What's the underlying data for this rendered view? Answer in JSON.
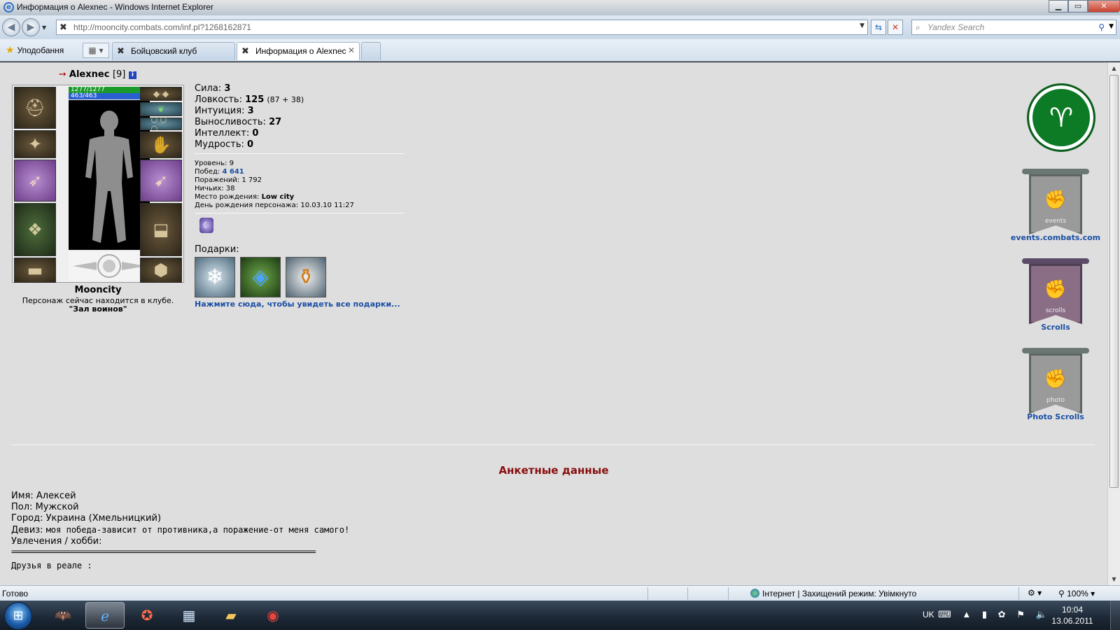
{
  "window": {
    "title": "Информация о Alexnec - Windows Internet Explorer",
    "minimize": "▁",
    "maximize": "▭",
    "close": "✕"
  },
  "address_bar": {
    "url": "http://mooncity.combats.com/inf.pl?1268162871",
    "search_placeholder": "Yandex Search"
  },
  "favorites": {
    "label": "Уподобання"
  },
  "tabs": [
    {
      "label": "Бойцовский клуб",
      "active": false
    },
    {
      "label": "Информация о Alexnec",
      "active": true
    }
  ],
  "character": {
    "name": "Alexnec",
    "level": "[9]",
    "hp": "1277/1277",
    "mp": "463/463",
    "club_city": "Mooncity",
    "location_note": "Персонаж сейчас находится в клубе.",
    "location_name": "\"Зал воинов\""
  },
  "stats": {
    "strength_label": "Сила:",
    "strength": "3",
    "agility_label": "Ловкость:",
    "agility": "125",
    "agility_detail": "(87 + 38)",
    "intuition_label": "Интуиция:",
    "intuition": "3",
    "endurance_label": "Выносливость:",
    "endurance": "27",
    "intellect_label": "Интеллект:",
    "intellect": "0",
    "wisdom_label": "Мудрость:",
    "wisdom": "0"
  },
  "info": {
    "level_label": "Уровень:",
    "level": "9",
    "wins_label": "Побед:",
    "wins": "4 641",
    "losses_label": "Поражений:",
    "losses": "1 792",
    "draws_label": "Ничьих:",
    "draws": "38",
    "birthplace_label": "Место рождения:",
    "birthplace": "Low city",
    "birthday_label": "День рождения персонажа:",
    "birthday": "10.03.10 11:27"
  },
  "gifts": {
    "label": "Подарки:",
    "link": "Нажмите сюда, чтобы увидеть все подарки..."
  },
  "side_links": [
    {
      "caption": "events.combats.com",
      "word": "events"
    },
    {
      "caption": "Scrolls",
      "word": "scrolls"
    },
    {
      "caption": "Photo Scrolls",
      "word": "photo"
    }
  ],
  "profile": {
    "heading": "Анкетные данные",
    "name_label": "Имя:",
    "name": "Алексей",
    "gender_label": "Пол:",
    "gender": "Мужской",
    "city_label": "Город:",
    "city": "Украина (Хмельницкий)",
    "motto_label": "Девиз:",
    "motto": "моя победа-зависит от противника,а поражение-от меня самого!",
    "hobby_label": "Увлечения / хобби:",
    "divider": "===================================================================================",
    "friends": "Друзья в реале :"
  },
  "statusbar": {
    "ready": "Готово",
    "zone": "Інтернет | Захищений режим: Увімкнуто",
    "zoom": "100%"
  },
  "taskbar": {
    "lang": "UK",
    "time": "10:04",
    "date": "13.06.2011"
  },
  "icons": {
    "app": "ie-icon",
    "back": "back-arrow-icon",
    "forward": "forward-arrow-icon",
    "refresh": "refresh-icon",
    "stop": "stop-icon",
    "search": "search-icon",
    "star": "favorites-star-icon"
  },
  "colors": {
    "link_blue": "#1b4fa3",
    "heading_red": "#8a0d0d",
    "hp_green": "#1a9a2a",
    "mp_blue": "#2a5fd0",
    "page_bg": "#dedede"
  }
}
